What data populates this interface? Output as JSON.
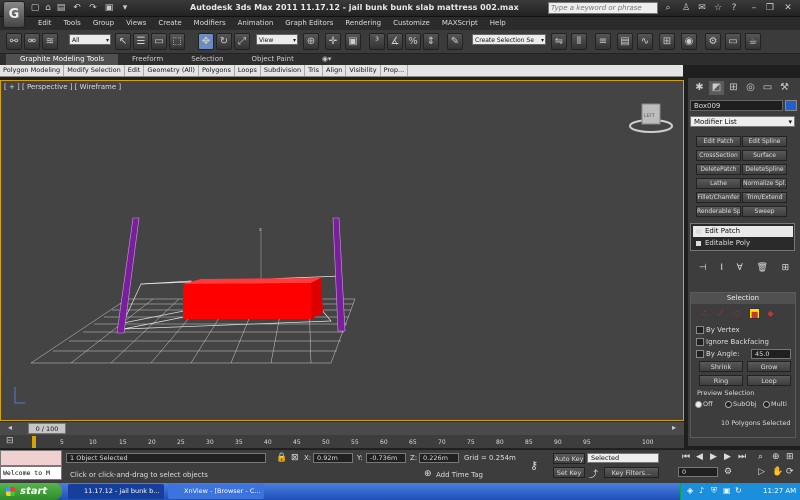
{
  "window": {
    "title": "Autodesk 3ds Max  2011       11.17.12 - jail bunk bunk slab mattress 002.max",
    "search_placeholder": "Type a keyword or phrase"
  },
  "menu": [
    "Edit",
    "Tools",
    "Group",
    "Views",
    "Create",
    "Modifiers",
    "Animation",
    "Graph Editors",
    "Rendering",
    "Customize",
    "MAXScript",
    "Help"
  ],
  "toolbar": {
    "selection_filter": "All",
    "ref_coord": "View",
    "named_selection": "Create Selection Se"
  },
  "ribbon": {
    "tabs": [
      "Graphite Modeling Tools",
      "Freeform",
      "Selection",
      "Object Paint"
    ],
    "sub": [
      "Polygon Modeling",
      "Modify Selection",
      "Edit",
      "Geometry (All)",
      "Polygons",
      "Loops",
      "Subdivision",
      "Tris",
      "Align",
      "Visibility",
      "Prop..."
    ]
  },
  "viewport": {
    "label": "[ + ] [ Perspective ] [ Wireframe ]",
    "gizmo_label": "LEFT"
  },
  "command_panel": {
    "object_name": "Box009",
    "object_color": "#1f5fd0",
    "modifier_list": "Modifier List",
    "modifier_buttons": [
      "Edit Patch",
      "Edit Spline",
      "CrossSection",
      "Surface",
      "DeletePatch",
      "DeleteSpline",
      "Lathe",
      "Normalize Spl.",
      "Fillet/Chamfer",
      "Trim/Extend",
      "Renderable Spline",
      "Sweep"
    ],
    "stack": [
      "Edit Patch",
      "Editable Poly"
    ],
    "selection": {
      "title": "Selection",
      "by_vertex": "By Vertex",
      "ignore_backfacing": "Ignore Backfacing",
      "by_angle": "By Angle:",
      "angle_value": "45.0",
      "shrink": "Shrink",
      "grow": "Grow",
      "ring": "Ring",
      "loop": "Loop",
      "preview_title": "Preview Selection",
      "off": "Off",
      "subobj": "SubObj",
      "multi": "Multi",
      "status": "10 Polygons Selected"
    }
  },
  "timeline": {
    "slider": "0 / 100",
    "ticks": [
      "5",
      "10",
      "15",
      "20",
      "25",
      "30",
      "35",
      "40",
      "45",
      "50",
      "55",
      "60",
      "65",
      "70",
      "75",
      "80",
      "85",
      "90",
      "95",
      "100"
    ]
  },
  "status": {
    "listener": "Welcome to M",
    "objects_selected": "1 Object Selected",
    "prompt": "Click or click-and-drag to select objects",
    "x_label": "X:",
    "x": "0.92m",
    "y_label": "Y:",
    "y": "-0.736m",
    "z_label": "Z:",
    "z": "0.226m",
    "grid": "Grid = 0.254m",
    "add_time_tag": "Add Time Tag",
    "auto_key": "Auto Key",
    "set_key": "Set Key",
    "selected": "Selected",
    "key_filters": "Key Filters...",
    "frame": "0"
  },
  "taskbar": {
    "start": "start",
    "tasks": [
      "11.17.12 - jail bunk b...",
      "XnView - [Browser - C..."
    ],
    "clock": "11:27 AM"
  }
}
